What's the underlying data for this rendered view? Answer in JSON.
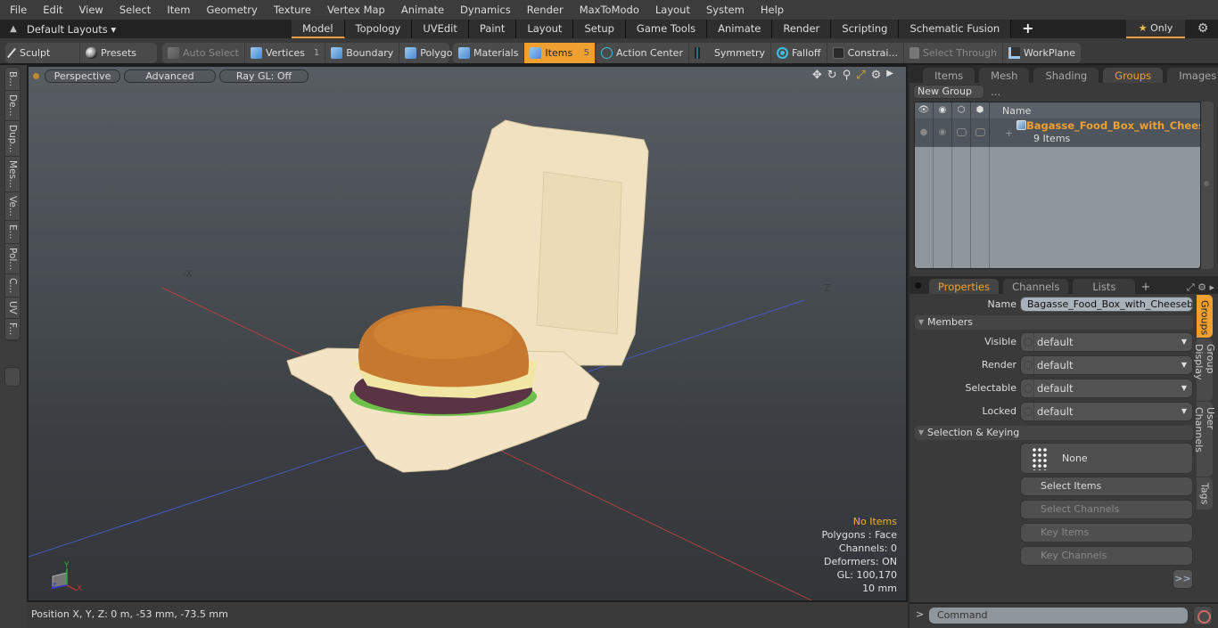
{
  "menu": [
    "File",
    "Edit",
    "View",
    "Select",
    "Item",
    "Geometry",
    "Texture",
    "Vertex Map",
    "Animate",
    "Dynamics",
    "Render",
    "MaxToModo",
    "Layout",
    "System",
    "Help"
  ],
  "layout_bar": {
    "layouts_label": "Default Layouts ▾",
    "tabs": [
      "Model",
      "Topology",
      "UVEdit",
      "Paint",
      "Layout",
      "Setup",
      "Game Tools",
      "Animate",
      "Render",
      "Scripting",
      "Schematic Fusion"
    ],
    "active_tab": "Model",
    "add_tab": "+",
    "only_label": "Only",
    "only_star": "★",
    "gear": "⚙"
  },
  "toolbar": {
    "sculpt": "Sculpt",
    "presets": "Presets",
    "auto_select": "Auto Select",
    "vertices": "Vertices",
    "vertices_count": "1",
    "boundary": "Boundary",
    "polygons": "Polygons",
    "materials": "Materials",
    "items": "Items",
    "items_count": "5",
    "action_center": "Action Center",
    "symmetry": "Symmetry",
    "falloff": "Falloff",
    "constraints": "Constrai...",
    "select_through": "Select Through",
    "workplane": "WorkPlane"
  },
  "left_tabs": [
    "B...",
    "De...",
    "Dup...",
    "Mes...",
    "Ve...",
    "E...",
    "Pol...",
    "C...",
    "UV",
    "F..."
  ],
  "viewport": {
    "view_mode": "Perspective",
    "shading": "Advanced",
    "raygl": "Ray GL: Off",
    "icons": [
      "move-icon",
      "rotate-icon",
      "zoom-icon",
      "maximize-icon",
      "gear-icon",
      "more-icon"
    ],
    "axis_labels": {
      "x": "-X",
      "z": "-Z"
    },
    "info": {
      "selection": "No Items",
      "polygons": "Polygons : Face",
      "channels": "Channels: 0",
      "deformers": "Deformers: ON",
      "gl": "GL: 100,170",
      "scale": "10 mm"
    },
    "axis_gizmo": {
      "x": "X",
      "y": "Y",
      "z": "Z"
    }
  },
  "status": {
    "position": "Position X, Y, Z:   0 m, -53 mm, -73.5 mm"
  },
  "groups_panel": {
    "tabs": [
      "Items",
      "Mesh ...",
      "Shading",
      "Groups",
      "Images"
    ],
    "active_tab": "Groups",
    "new_group": "New Group",
    "column_name": "Name",
    "group": {
      "name": "Bagasse_Food_Box_with_Chees...",
      "count": "9 Items"
    }
  },
  "properties_panel": {
    "tabs": [
      "Properties",
      "Channels",
      "Lists"
    ],
    "active_tab": "Properties",
    "name_label": "Name",
    "name_value": "Bagasse_Food_Box_with_Cheeseburg",
    "members_section": "Members",
    "fields": [
      {
        "label": "Visible",
        "value": "default"
      },
      {
        "label": "Render",
        "value": "default"
      },
      {
        "label": "Selectable",
        "value": "default"
      },
      {
        "label": "Locked",
        "value": "default"
      }
    ],
    "selection_section": "Selection & Keying",
    "none_button": "None",
    "select_items": "Select Items",
    "select_channels": "Select Channels",
    "key_items": "Key Items",
    "key_channels": "Key Channels",
    "more": ">>",
    "side_tabs": [
      "Groups",
      "Group Display",
      "User Channels",
      "Tags"
    ],
    "active_side_tab": "Groups"
  },
  "command": {
    "prompt": ">",
    "placeholder": "Command"
  }
}
